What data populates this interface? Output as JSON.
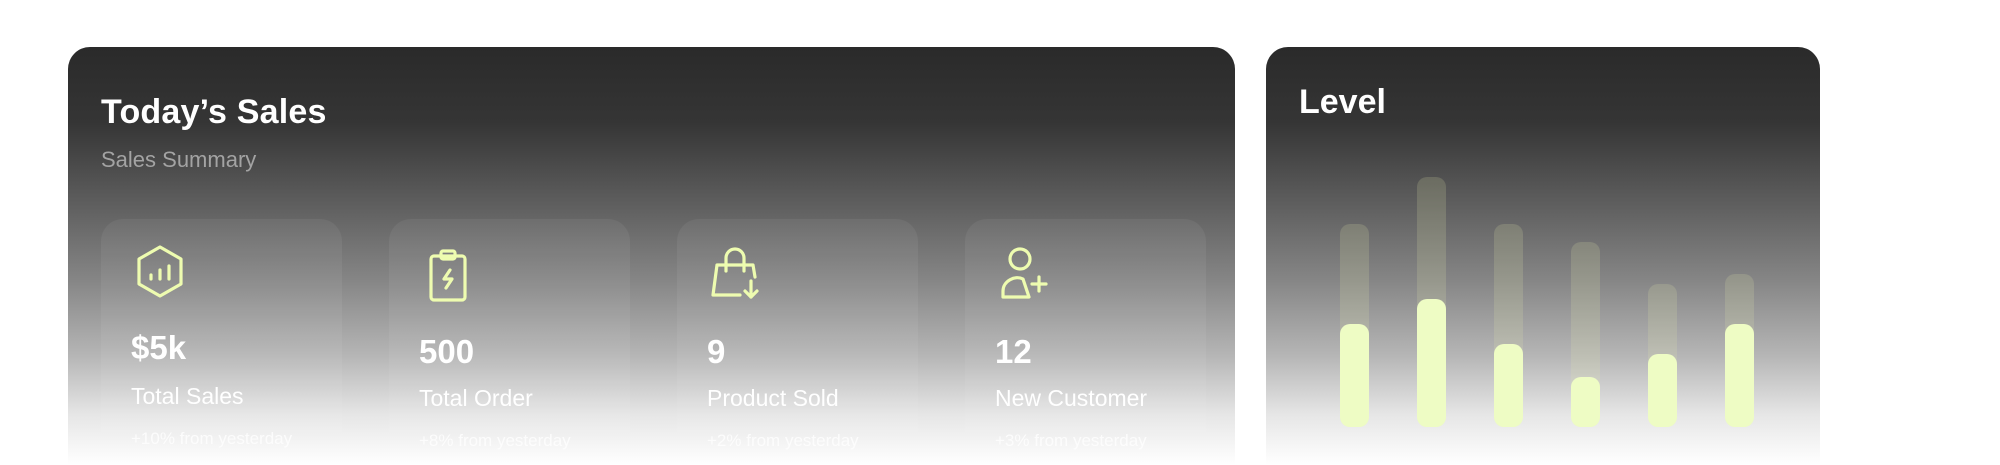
{
  "sales": {
    "title": "Today’s Sales",
    "subtitle": "Sales Summary",
    "accent_color": "#eefcb0",
    "cards": [
      {
        "icon": "chart-hexagon-icon",
        "value": "$5k",
        "label": "Total Sales",
        "change": "+10% from yesterday"
      },
      {
        "icon": "clipboard-bolt-icon",
        "value": "500",
        "label": "Total Order",
        "change": "+8% from yesterday"
      },
      {
        "icon": "shopping-bag-download-icon",
        "value": "9",
        "label": "Product Sold",
        "change": "+2% from yesterday"
      },
      {
        "icon": "user-add-icon",
        "value": "12",
        "label": "New Customer",
        "change": "+3% from yesterday"
      }
    ]
  },
  "level": {
    "title": "Level",
    "bar_color": "#eefcc4",
    "track_color": "#e1ebaa",
    "bars": [
      {
        "track": 0.81,
        "fill": 0.41
      },
      {
        "track": 1.0,
        "fill": 0.51
      },
      {
        "track": 0.81,
        "fill": 0.33
      },
      {
        "track": 0.74,
        "fill": 0.2
      },
      {
        "track": 0.57,
        "fill": 0.29
      },
      {
        "track": 0.61,
        "fill": 0.41
      }
    ]
  }
}
